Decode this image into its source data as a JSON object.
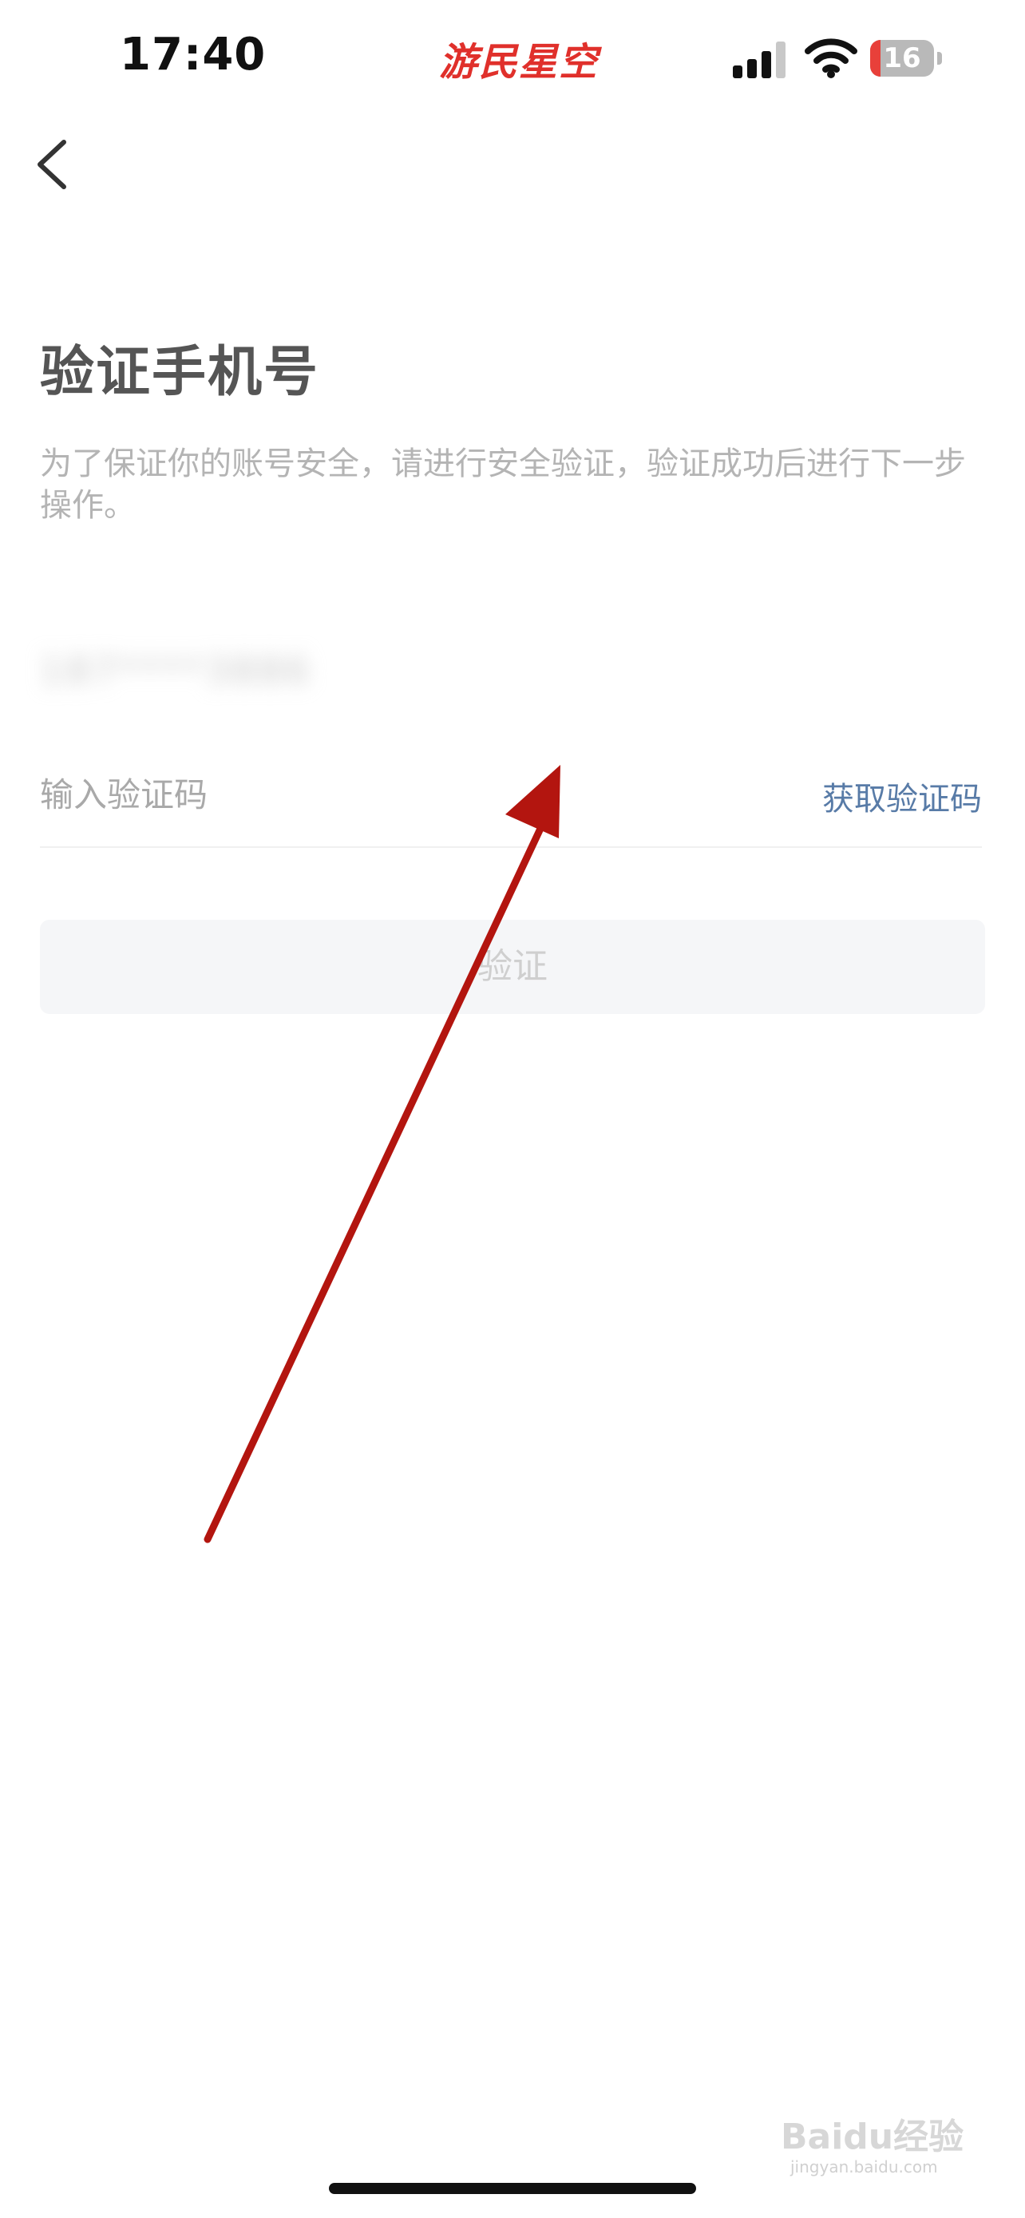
{
  "status_bar": {
    "time": "17:40",
    "brand": "游民星空",
    "battery_level": "16",
    "battery_fraction": 0.16,
    "icons": [
      "signal-icon",
      "wifi-icon",
      "battery-icon"
    ]
  },
  "nav": {
    "back_icon": "chevron-left-icon"
  },
  "page": {
    "title": "验证手机号",
    "description": "为了保证你的账号安全，请进行安全验证，验证成功后进行下一步操作。"
  },
  "form": {
    "phone_masked": "187****3886",
    "code_placeholder": "输入验证码",
    "get_code_label": "获取验证码",
    "verify_label": "验证"
  },
  "watermark": {
    "text": "Baidu经验",
    "sub": "jingyan.baidu.com"
  },
  "colors": {
    "accent_link": "#587ba7",
    "brand_red": "#e0302b",
    "arrow_red": "#b3150f",
    "button_bg": "#f5f6f8"
  }
}
